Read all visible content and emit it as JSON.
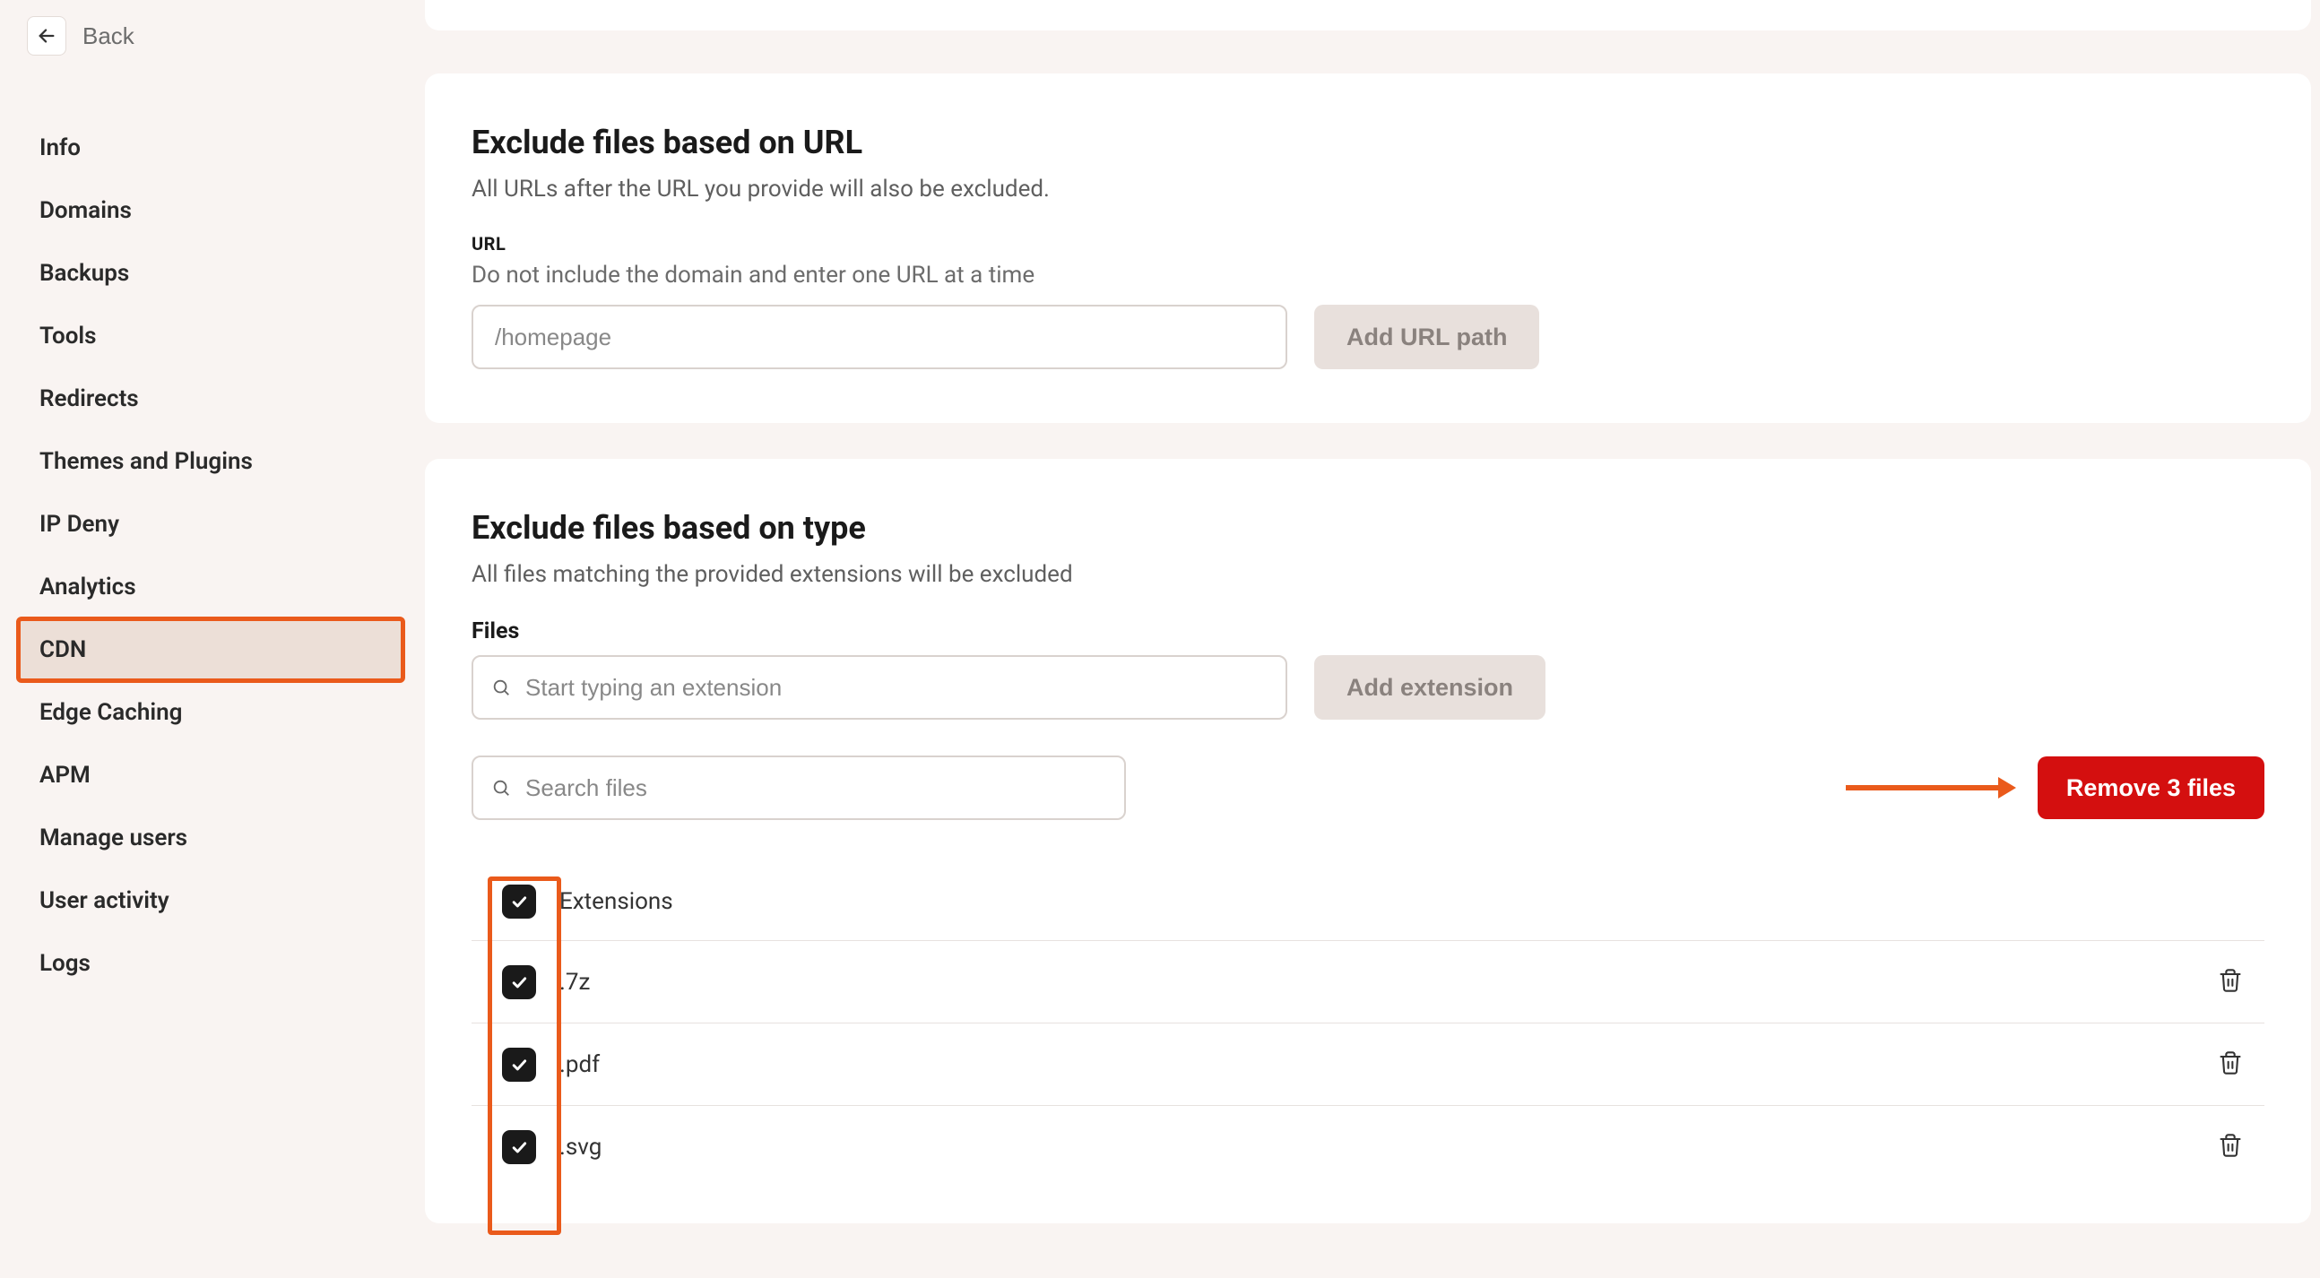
{
  "back": {
    "label": "Back"
  },
  "sidebar": {
    "items": [
      {
        "label": "Info"
      },
      {
        "label": "Domains"
      },
      {
        "label": "Backups"
      },
      {
        "label": "Tools"
      },
      {
        "label": "Redirects"
      },
      {
        "label": "Themes and Plugins"
      },
      {
        "label": "IP Deny"
      },
      {
        "label": "Analytics"
      },
      {
        "label": "CDN"
      },
      {
        "label": "Edge Caching"
      },
      {
        "label": "APM"
      },
      {
        "label": "Manage users"
      },
      {
        "label": "User activity"
      },
      {
        "label": "Logs"
      }
    ],
    "active_index": 8
  },
  "url_card": {
    "title": "Exclude files based on URL",
    "desc": "All URLs after the URL you provide will also be excluded.",
    "field_label": "URL",
    "helper": "Do not include the domain and enter one URL at a time",
    "placeholder": "/homepage",
    "button": "Add URL path"
  },
  "type_card": {
    "title": "Exclude files based on type",
    "desc": "All files matching the provided extensions will be excluded",
    "files_label": "Files",
    "ext_placeholder": "Start typing an extension",
    "add_ext_button": "Add extension",
    "search_placeholder": "Search files",
    "remove_button": "Remove 3 files",
    "table_header": "Extensions",
    "rows": [
      {
        "ext": ".7z"
      },
      {
        "ext": ".pdf"
      },
      {
        "ext": ".svg"
      }
    ]
  }
}
